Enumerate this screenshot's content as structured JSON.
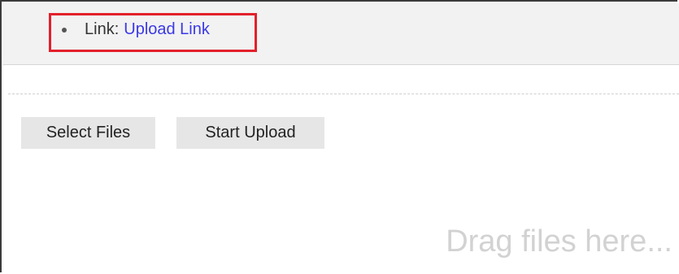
{
  "link_item": {
    "label": "Link:",
    "link_text": "Upload Link"
  },
  "toolbar": {
    "select_files_label": "Select Files",
    "start_upload_label": "Start Upload"
  },
  "drop_zone": {
    "hint": "Drag files here..."
  },
  "colors": {
    "link": "#3b39e6",
    "highlight_border": "#e3202c",
    "button_bg": "#e6e6e6",
    "top_bar_bg": "#f2f2f2"
  }
}
